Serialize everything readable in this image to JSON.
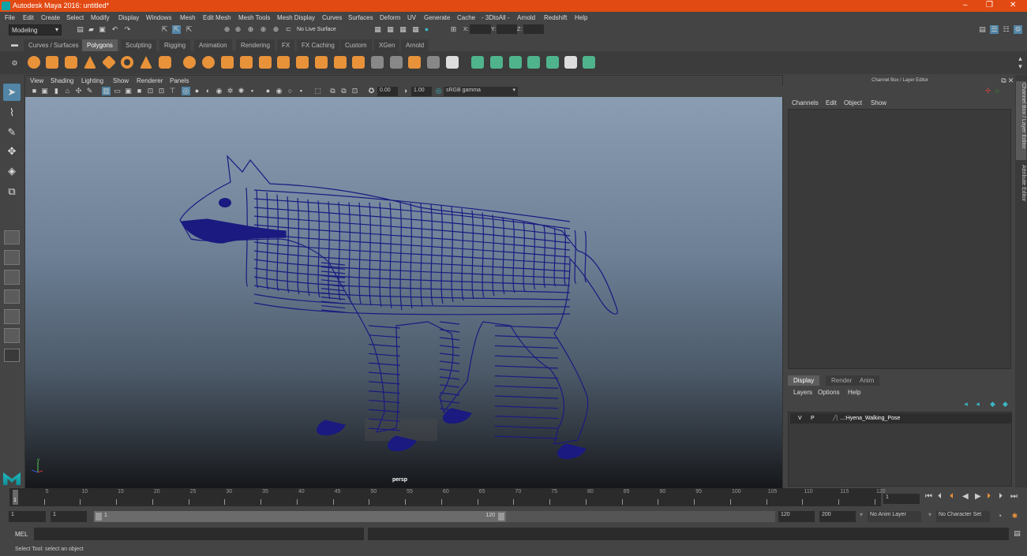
{
  "window": {
    "title": "Autodesk Maya 2016: untitled*",
    "controls": [
      "minimize",
      "restore",
      "close"
    ]
  },
  "menubar": [
    "File",
    "Edit",
    "Create",
    "Select",
    "Modify",
    "Display",
    "Windows",
    "Mesh",
    "Edit Mesh",
    "Mesh Tools",
    "Mesh Display",
    "Curves",
    "Surfaces",
    "Deform",
    "UV",
    "Generate",
    "Cache",
    "- 3DtoAll -",
    "Arnold",
    "Redshift",
    "Help"
  ],
  "statusline": {
    "mode": "Modeling",
    "live_surface": "No Live Surface",
    "x_label": "X:",
    "y_label": "Y:",
    "z_label": "Z:",
    "x": "",
    "y": "",
    "z": ""
  },
  "shelf": {
    "tabs": [
      "Curves / Surfaces",
      "Polygons",
      "Sculpting",
      "Rigging",
      "Animation",
      "Rendering",
      "FX",
      "FX Caching",
      "Custom",
      "XGen",
      "Arnold"
    ],
    "active_tab": "Polygons"
  },
  "viewport": {
    "menu": [
      "View",
      "Shading",
      "Lighting",
      "Show",
      "Renderer",
      "Panels"
    ],
    "exposure": "0.00",
    "gamma": "1.00",
    "color_space": "sRGB gamma",
    "camera_label": "persp",
    "axis_label": "y",
    "wireframe_color": "#1a1a80"
  },
  "channel_box": {
    "header": "Channel Box / Layer Editor",
    "menu": [
      "Channels",
      "Edit",
      "Object",
      "Show"
    ]
  },
  "layer_editor": {
    "tabs": [
      "Display",
      "Render",
      "Anim"
    ],
    "active_tab": "Display",
    "menu": [
      "Layers",
      "Options",
      "Help"
    ],
    "layers": [
      {
        "visible": "V",
        "playback": "P",
        "name": "...:Hyena_Walking_Pose"
      }
    ]
  },
  "side_tabs": [
    "Channel Box / Layer Editor",
    "Attribute Editor"
  ],
  "timeline": {
    "ticks": [
      "5",
      "10",
      "15",
      "20",
      "25",
      "30",
      "35",
      "40",
      "45",
      "50",
      "55",
      "60",
      "65",
      "70",
      "75",
      "80",
      "85",
      "90",
      "95",
      "100",
      "105",
      "110",
      "115",
      "120"
    ],
    "current_frame": "1",
    "current_frame_field": "1"
  },
  "range": {
    "start": "1",
    "anim_start": "1",
    "slider_start": "1",
    "slider_end": "120",
    "end": "120",
    "anim_end": "200",
    "anim_layer": "No Anim Layer",
    "character_set": "No Character Set"
  },
  "command_line": {
    "label": "MEL"
  },
  "help_line": "Select Tool: select an object"
}
